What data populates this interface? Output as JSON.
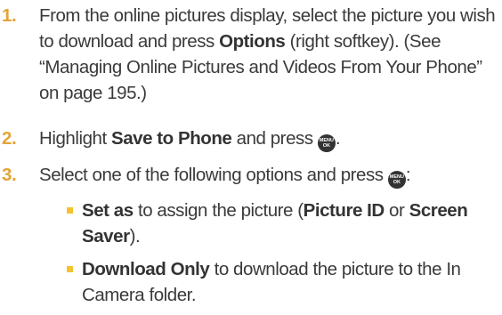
{
  "steps": [
    {
      "number": "1.",
      "text_a": "From the online pictures display, select the picture you wish to download and press ",
      "bold_a": "Options",
      "text_b": " (right softkey). (See “Managing Online Pictures and Videos From Your Phone” on page 195.)"
    },
    {
      "number": "2.",
      "text_a": "Highlight ",
      "bold_a": "Save to Phone",
      "text_b": " and press ",
      "text_c": "."
    },
    {
      "number": "3.",
      "text_a": "Select one of the following options and press ",
      "text_c": ":"
    }
  ],
  "menu_key": {
    "top": "MENU",
    "bottom": "OK",
    "icon": "menu-ok-key-icon"
  },
  "options": [
    {
      "bold_a": "Set as",
      "text_a": " to assign the picture (",
      "bold_b": "Picture ID",
      "text_b": " or ",
      "bold_c": "Screen Saver",
      "text_c": ")."
    },
    {
      "bold_a": "Download Only",
      "text_a": " to download the picture to the In Camera folder."
    }
  ],
  "colors": {
    "number": "#e3a437",
    "bullet": "#f2c230",
    "text": "#3a3a3a"
  }
}
